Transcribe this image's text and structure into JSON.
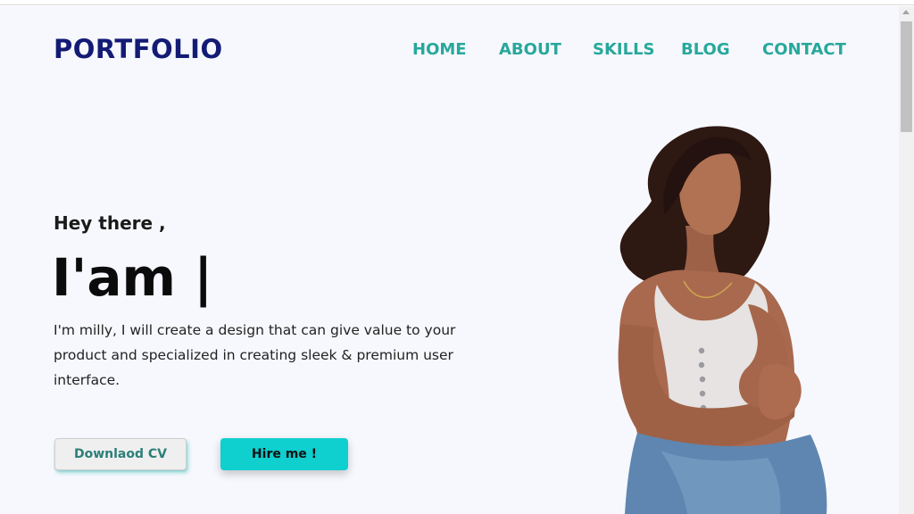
{
  "header": {
    "logo": "PORTFOLIO",
    "nav": [
      "HOME",
      "ABOUT",
      "SKILLS",
      "BLOG",
      "CONTACT"
    ]
  },
  "hero": {
    "greeting": "Hey there ,",
    "headline": "I'am |",
    "intro": "I'm milly, I will create a design that can give value to your product and specialized in creating sleek & premium user interface.",
    "buttons": {
      "cv": "Downlaod CV",
      "hire": "Hire me !"
    },
    "image": "woman-portrait"
  },
  "colors": {
    "logo": "#141b75",
    "nav": "#27a89c",
    "hire_button": "#0fcfcf",
    "cv_text": "#2b7f78",
    "background": "#f7f8fd"
  }
}
